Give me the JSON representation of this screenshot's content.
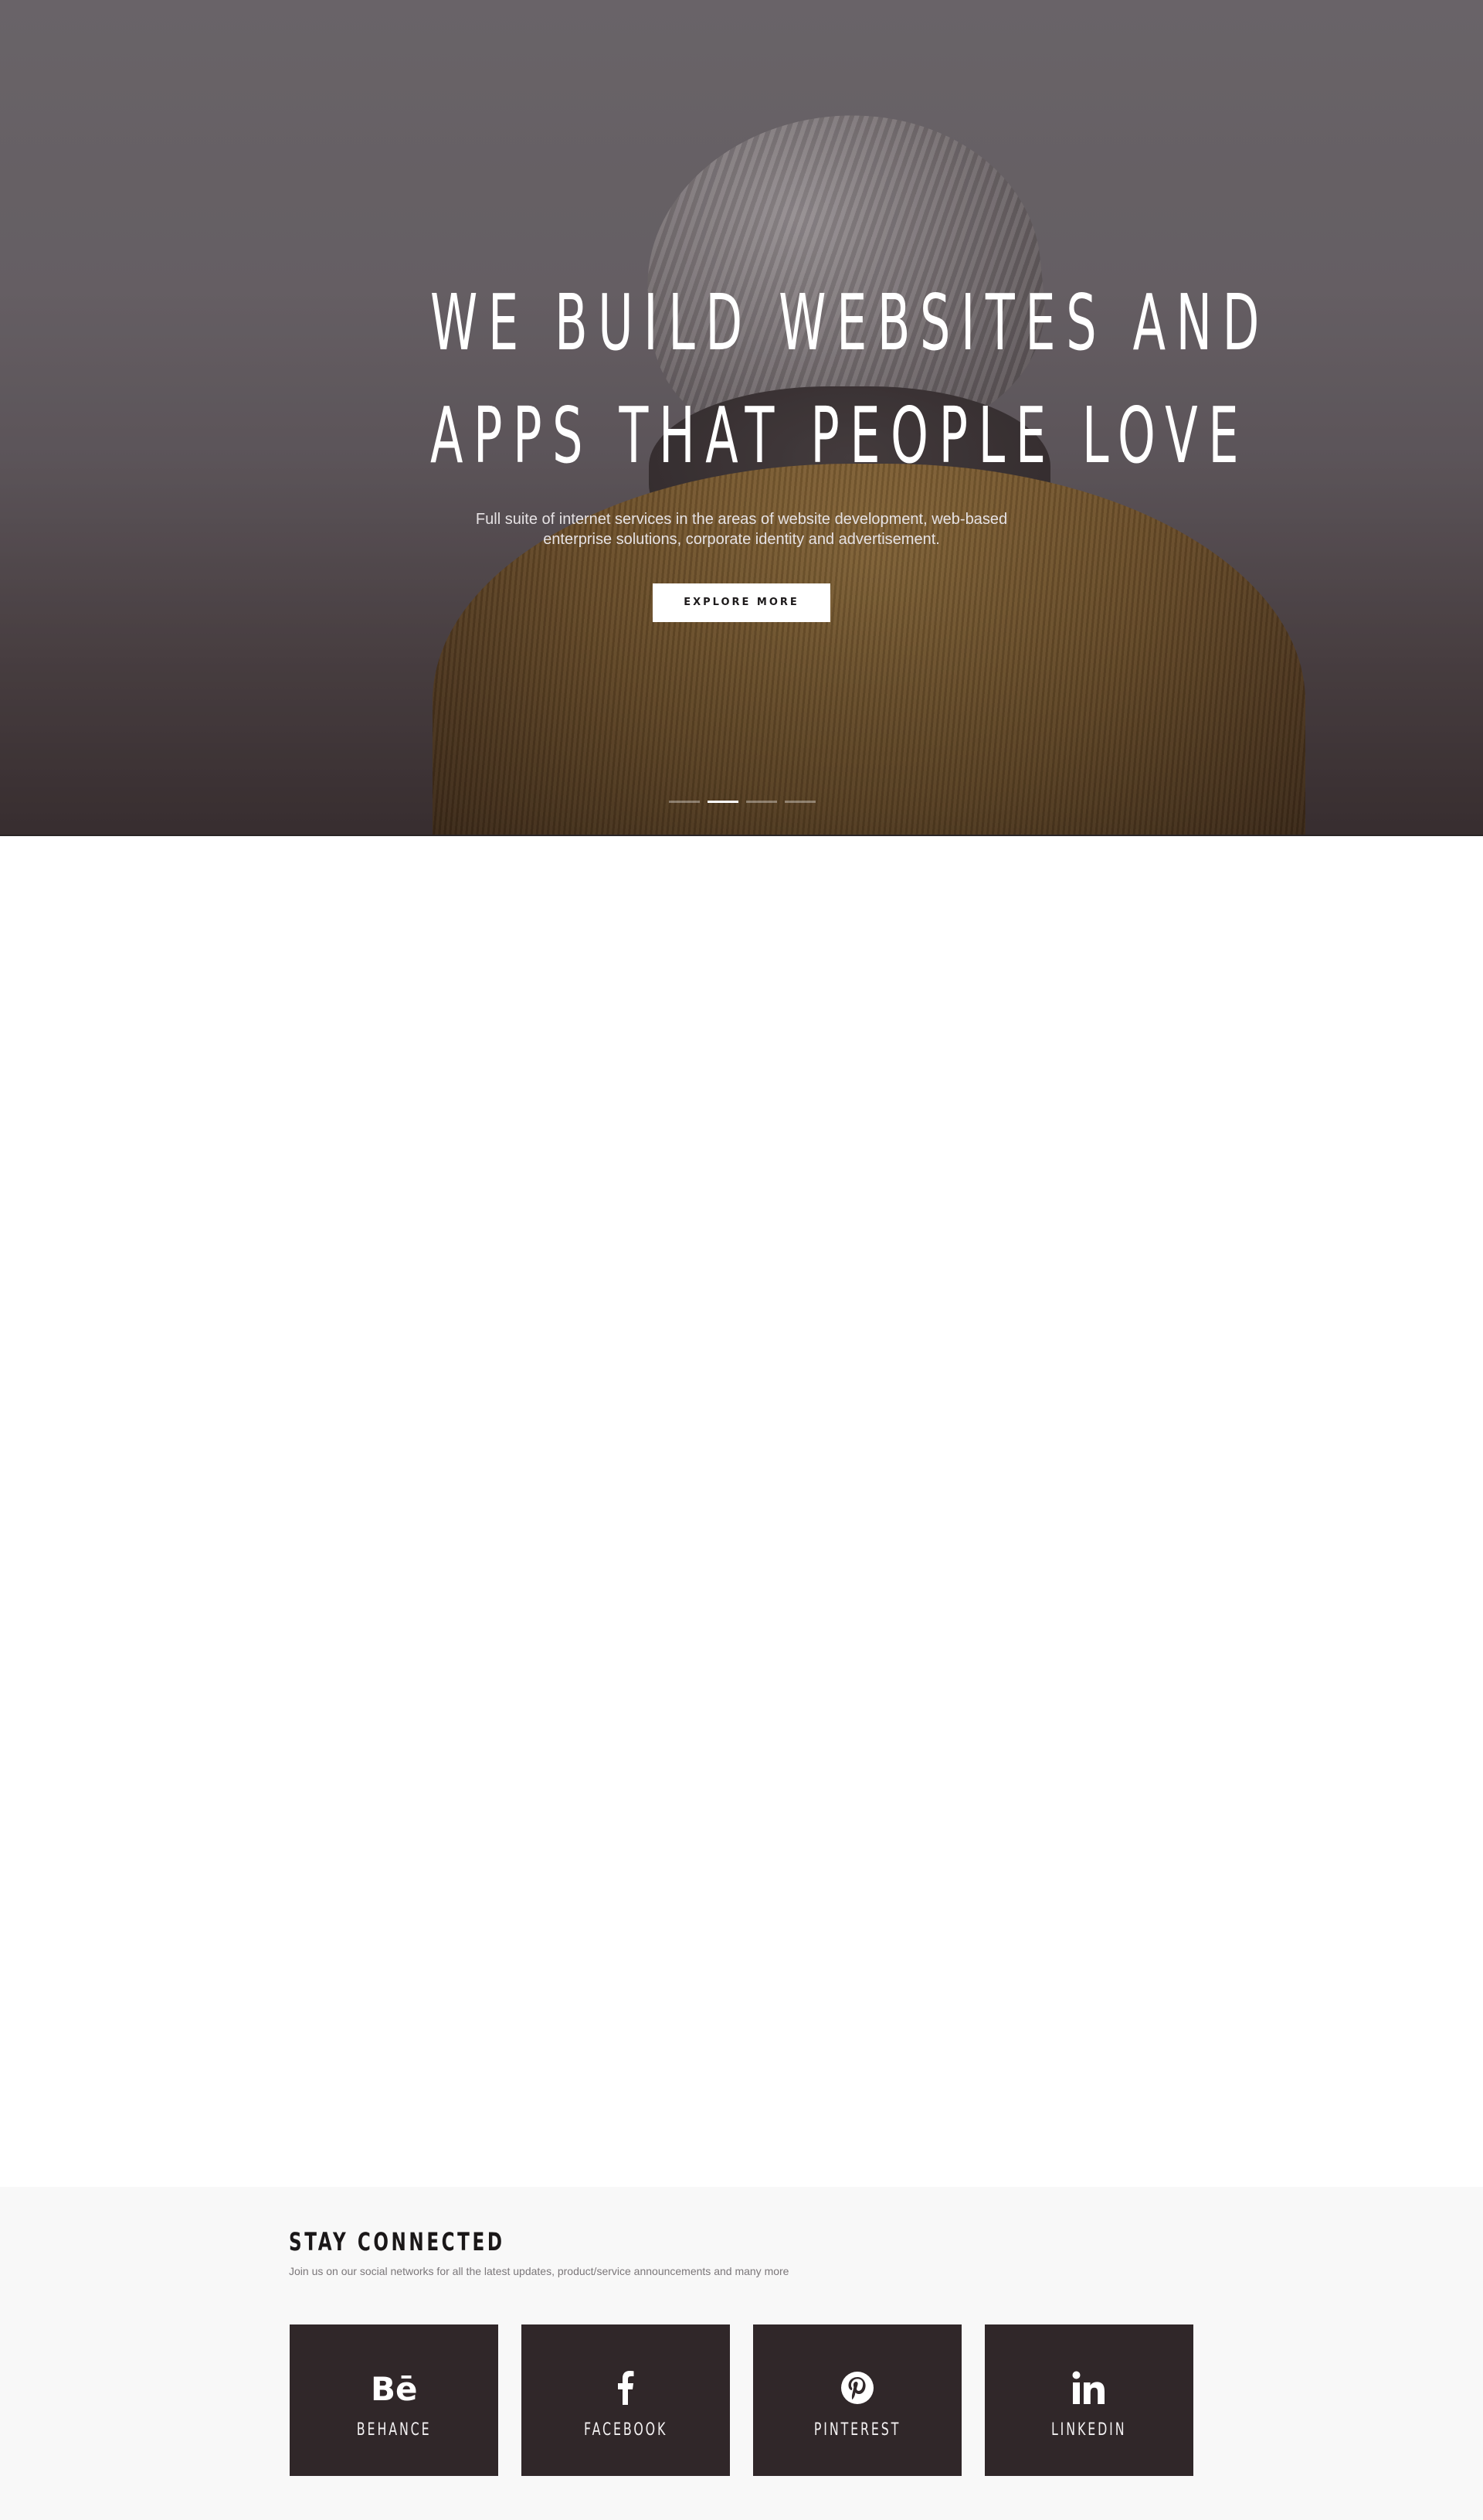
{
  "hero": {
    "title_line1": "WE BUILD WEBSITES AND",
    "title_line2": "APPS THAT PEOPLE LOVE",
    "subtitle_line1": "Full suite of internet services in the areas of website development, web-based",
    "subtitle_line2": "enterprise solutions, corporate identity and advertisement.",
    "button_label": "EXPLORE MORE",
    "slides": [
      {
        "active": false
      },
      {
        "active": true
      },
      {
        "active": false
      },
      {
        "active": false
      }
    ]
  },
  "connect": {
    "title": "STAY CONNECTED",
    "subtitle": "Join us on our social networks for all the latest updates, product/service announcements and many more",
    "networks": [
      {
        "label": "BEHANCE",
        "icon": "behance-icon"
      },
      {
        "label": "FACEBOOK",
        "icon": "facebook-icon"
      },
      {
        "label": "PINTEREST",
        "icon": "pinterest-icon"
      },
      {
        "label": "LINKEDIN",
        "icon": "linkedin-icon"
      }
    ]
  },
  "colors": {
    "card_background": "#302729",
    "section_background": "#f8f8f8",
    "hero_text": "#ffffff"
  }
}
